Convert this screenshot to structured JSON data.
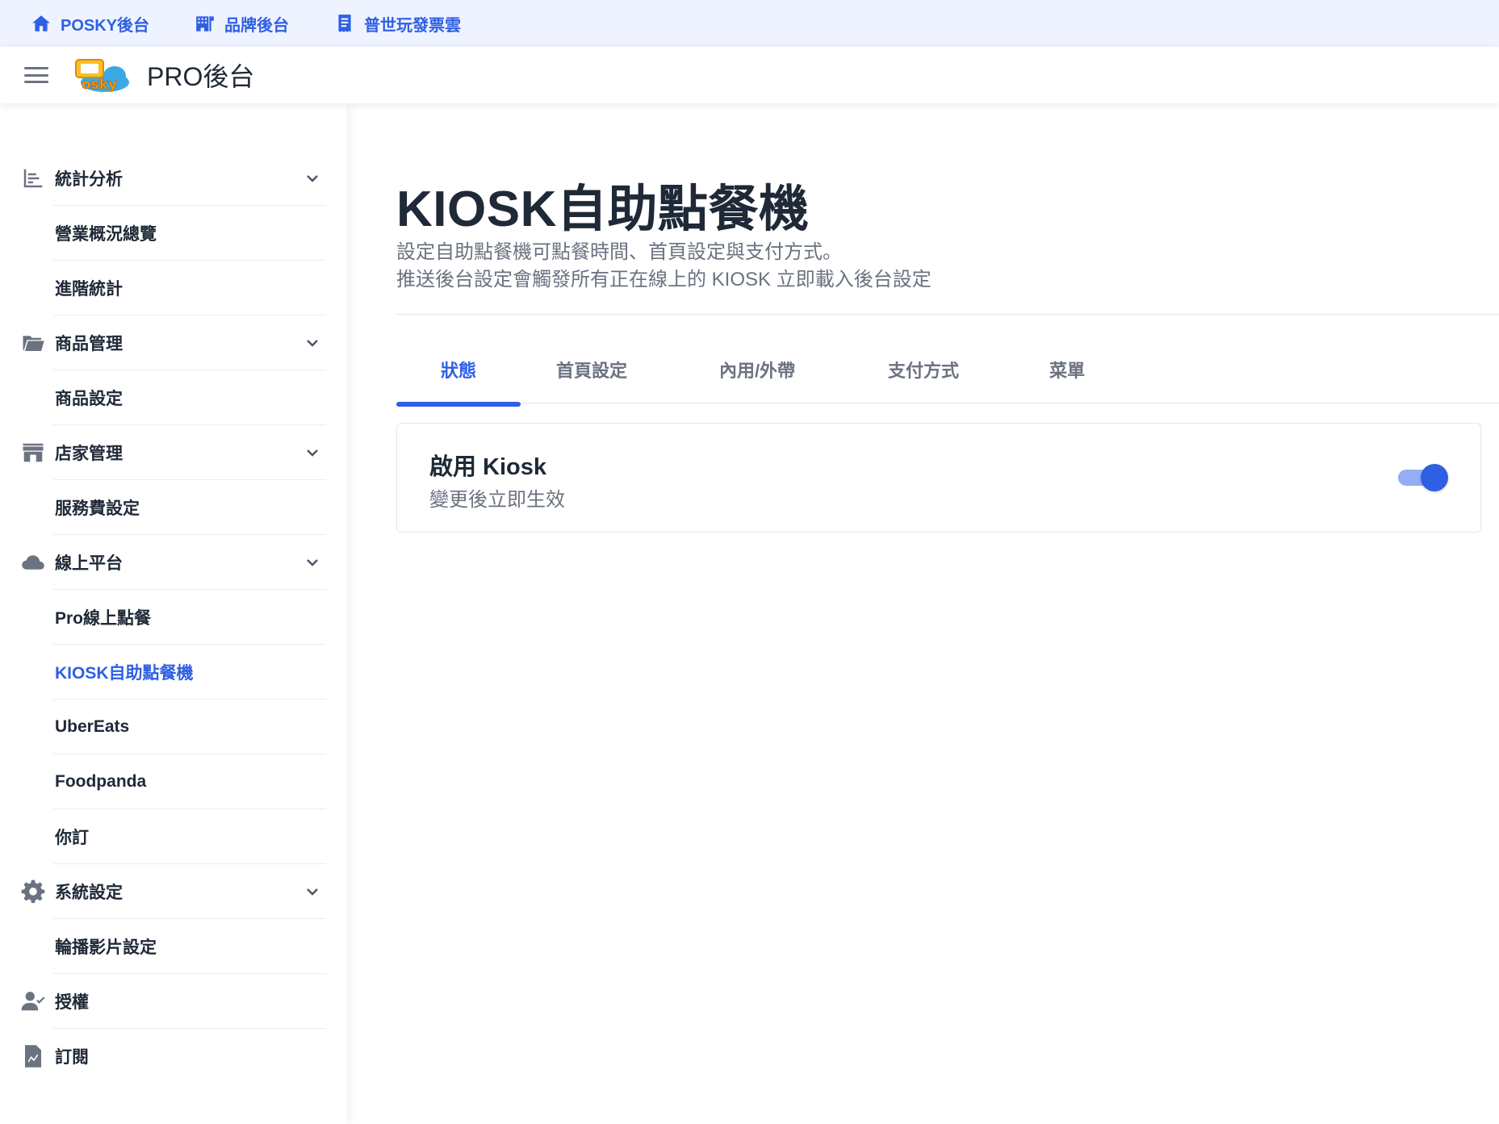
{
  "topbar": {
    "links": [
      {
        "label": "POSKY後台",
        "icon": "home-icon"
      },
      {
        "label": "品牌後台",
        "icon": "building-icon"
      },
      {
        "label": "普世玩發票雲",
        "icon": "receipt-icon"
      }
    ]
  },
  "header": {
    "title": "PRO後台",
    "logo": "posky-logo"
  },
  "sidebar": {
    "items": [
      {
        "label": "統計分析",
        "type": "group",
        "icon": "chart-icon"
      },
      {
        "label": "營業概況總覽",
        "type": "sub"
      },
      {
        "label": "進階統計",
        "type": "sub"
      },
      {
        "label": "商品管理",
        "type": "group",
        "icon": "folder-icon"
      },
      {
        "label": "商品設定",
        "type": "sub"
      },
      {
        "label": "店家管理",
        "type": "group",
        "icon": "store-icon"
      },
      {
        "label": "服務費設定",
        "type": "sub"
      },
      {
        "label": "線上平台",
        "type": "group",
        "icon": "cloud-icon"
      },
      {
        "label": "Pro線上點餐",
        "type": "sub"
      },
      {
        "label": "KIOSK自助點餐機",
        "type": "sub",
        "active": true
      },
      {
        "label": "UberEats",
        "type": "sub"
      },
      {
        "label": "Foodpanda",
        "type": "sub"
      },
      {
        "label": "你訂",
        "type": "sub"
      },
      {
        "label": "系統設定",
        "type": "group",
        "icon": "gear-icon"
      },
      {
        "label": "輪播影片設定",
        "type": "sub"
      },
      {
        "label": "授權",
        "type": "single",
        "icon": "user-check-icon"
      },
      {
        "label": "訂閱",
        "type": "single",
        "icon": "document-icon"
      }
    ]
  },
  "main": {
    "title": "KIOSK自助點餐機",
    "description_line1": "設定自助點餐機可點餐時間、首頁設定與支付方式。",
    "description_line2": "推送後台設定會觸發所有正在線上的 KIOSK 立即載入後台設定",
    "tabs": [
      {
        "label": "狀態",
        "active": true
      },
      {
        "label": "首頁設定"
      },
      {
        "label": "內用/外帶"
      },
      {
        "label": "支付方式"
      },
      {
        "label": "菜單"
      }
    ],
    "card": {
      "title": "啟用 Kiosk",
      "subtitle": "變更後立即生效",
      "toggle_on": true
    }
  },
  "colors": {
    "accent": "#2f5fe3",
    "topbar_bg": "#eef3ff",
    "muted_text": "#6b7280"
  }
}
